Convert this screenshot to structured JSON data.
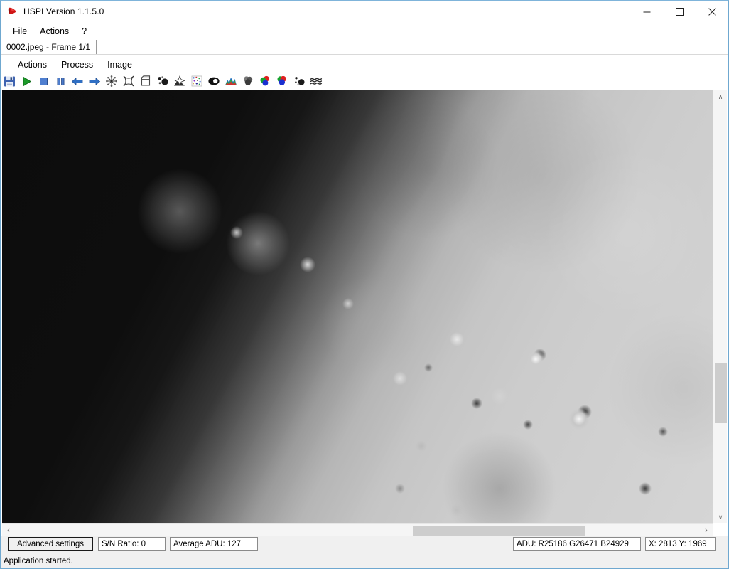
{
  "window": {
    "title": "HSPI Version 1.1.5.0",
    "icon": "app-logo-icon",
    "minimize_label": "—",
    "maximize_label": "☐",
    "close_label": "✕"
  },
  "menu_bar": {
    "items": [
      {
        "label": "File",
        "name": "menu-file"
      },
      {
        "label": "Actions",
        "name": "menu-actions"
      },
      {
        "label": "?",
        "name": "menu-help"
      }
    ]
  },
  "tab_strip": {
    "tabs": [
      {
        "label": "0002.jpeg - Frame 1/1",
        "name": "document-tab-0002"
      }
    ]
  },
  "inner_menu": {
    "items": [
      {
        "label": "Actions",
        "name": "inner-menu-actions"
      },
      {
        "label": "Process",
        "name": "inner-menu-process"
      },
      {
        "label": "Image",
        "name": "inner-menu-image"
      }
    ]
  },
  "toolbar": {
    "buttons": [
      {
        "name": "save-icon",
        "title": "Save"
      },
      {
        "name": "play-icon",
        "title": "Play"
      },
      {
        "name": "stop-icon",
        "title": "Stop"
      },
      {
        "name": "pause-icon",
        "title": "Pause"
      },
      {
        "name": "arrow-left-icon",
        "title": "Previous frame"
      },
      {
        "name": "arrow-right-icon",
        "title": "Next frame"
      },
      {
        "name": "snowflake-icon",
        "title": "Dark frame"
      },
      {
        "name": "star-flat-icon",
        "title": "Flat field"
      },
      {
        "name": "bias-frame-icon",
        "title": "Bias frame"
      },
      {
        "name": "hot-pixel-icon",
        "title": "Hot pixels"
      },
      {
        "name": "gradient-remove-icon",
        "title": "Gradient removal"
      },
      {
        "name": "noise-reduce-icon",
        "title": "Noise reduction"
      },
      {
        "name": "contrast-icon",
        "title": "Contrast"
      },
      {
        "name": "histogram-icon",
        "title": "Histogram"
      },
      {
        "name": "grayscale-blend-icon",
        "title": "Grayscale"
      },
      {
        "name": "rgb-align-icon",
        "title": "RGB align"
      },
      {
        "name": "rgb-combine-icon",
        "title": "RGB combine"
      },
      {
        "name": "dust-removal-icon",
        "title": "Dust removal"
      },
      {
        "name": "wavelet-icon",
        "title": "Wavelets"
      }
    ]
  },
  "canvas": {
    "name": "image-canvas",
    "description": "lunar terminator grayscale frame"
  },
  "scrollbars": {
    "vertical": {
      "up_label": "∧",
      "down_label": "∨"
    },
    "horizontal": {
      "left_label": "‹",
      "right_label": "›"
    }
  },
  "bottom_panel": {
    "advanced_settings_label": "Advanced settings",
    "sn_ratio": "S/N Ratio: 0",
    "average_adu": "Average ADU: 127",
    "adu_rgb": "ADU: R25186 G26471 B24929",
    "cursor_xy": "X: 2813 Y: 1969"
  },
  "status_bar": {
    "message": "Application started."
  },
  "colors": {
    "window_border": "#6fa8d0",
    "chrome_bg": "#ffffff",
    "panel_bg": "#f0f0f0",
    "scroll_thumb": "#cdcdcd",
    "accent_blue": "#0078d7"
  }
}
